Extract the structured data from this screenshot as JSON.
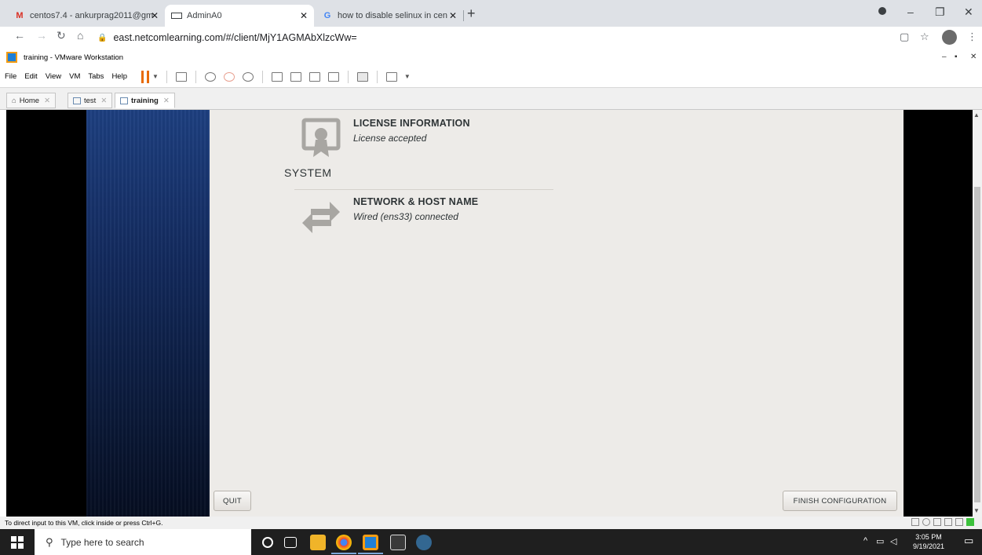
{
  "browser": {
    "tabs": [
      {
        "favicon": "gmail-icon",
        "title": "centos7.4 - ankurprag2011@gm",
        "active": false
      },
      {
        "favicon": "remote-desktop-icon",
        "title": "AdminA0",
        "active": true
      },
      {
        "favicon": "google-icon",
        "title": "how to disable selinux in centos",
        "active": false
      }
    ],
    "url": "east.netcomlearning.com/#/client/MjY1AGMAbXlzcWw="
  },
  "vmware": {
    "window_title": "training - VMware Workstation",
    "menu": [
      "File",
      "Edit",
      "View",
      "VM",
      "Tabs",
      "Help"
    ],
    "tabs": [
      {
        "label": "Home",
        "active": false
      },
      {
        "label": "test",
        "active": false
      },
      {
        "label": "training",
        "active": true
      }
    ],
    "status_text": "To direct input to this VM, click inside or press Ctrl+G."
  },
  "installer": {
    "license": {
      "title": "LICENSE INFORMATION",
      "status": "License accepted"
    },
    "system_heading": "SYSTEM",
    "network": {
      "title": "NETWORK & HOST NAME",
      "status": "Wired (ens33) connected"
    },
    "quit_label": "QUIT",
    "finish_label": "FINISH CONFIGURATION"
  },
  "taskbar": {
    "search_placeholder": "Type here to search",
    "time": "3:05 PM",
    "date": "9/19/2021"
  },
  "colors": {
    "installer_bg": "#edebe8",
    "sidebar_blue": "#1d3f80",
    "pause_orange": "#e86a00"
  }
}
